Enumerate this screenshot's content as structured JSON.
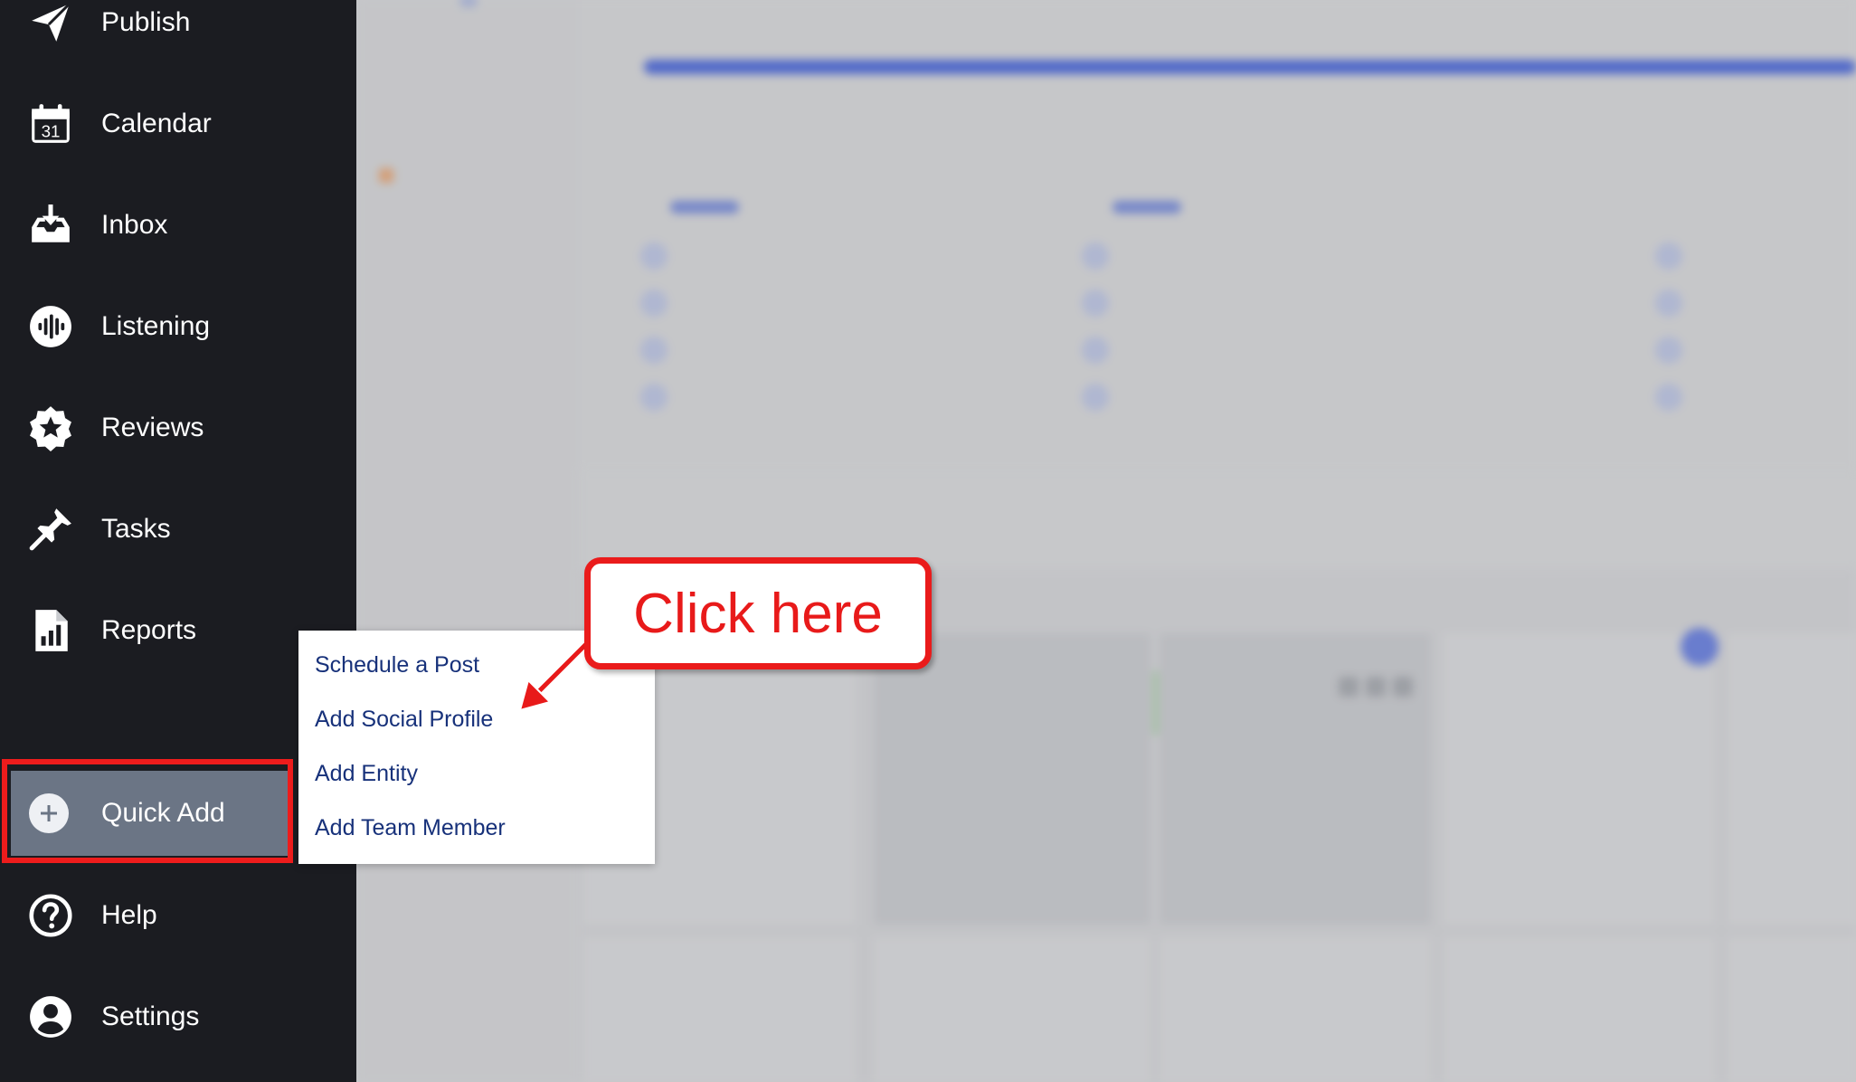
{
  "sidebar": {
    "items": [
      {
        "label": "Publish",
        "icon": "paper-plane-icon"
      },
      {
        "label": "Calendar",
        "icon": "calendar-icon",
        "badge": "31"
      },
      {
        "label": "Inbox",
        "icon": "inbox-icon"
      },
      {
        "label": "Listening",
        "icon": "listening-icon"
      },
      {
        "label": "Reviews",
        "icon": "star-icon"
      },
      {
        "label": "Tasks",
        "icon": "pin-icon"
      },
      {
        "label": "Reports",
        "icon": "report-icon"
      }
    ],
    "quick_add": {
      "label": "Quick Add",
      "icon": "plus-icon"
    },
    "bottom_items": [
      {
        "label": "Help",
        "icon": "help-icon"
      },
      {
        "label": "Settings",
        "icon": "user-icon"
      }
    ]
  },
  "quick_add_menu": {
    "items": [
      "Schedule a Post",
      "Add Social Profile",
      "Add Entity",
      "Add Team Member"
    ]
  },
  "callout": {
    "text": "Click here"
  },
  "colors": {
    "sidebar_bg": "#1b1c21",
    "quick_add_bg": "#6b7585",
    "highlight_red": "#ee1c1c",
    "menu_text": "#17317a"
  }
}
